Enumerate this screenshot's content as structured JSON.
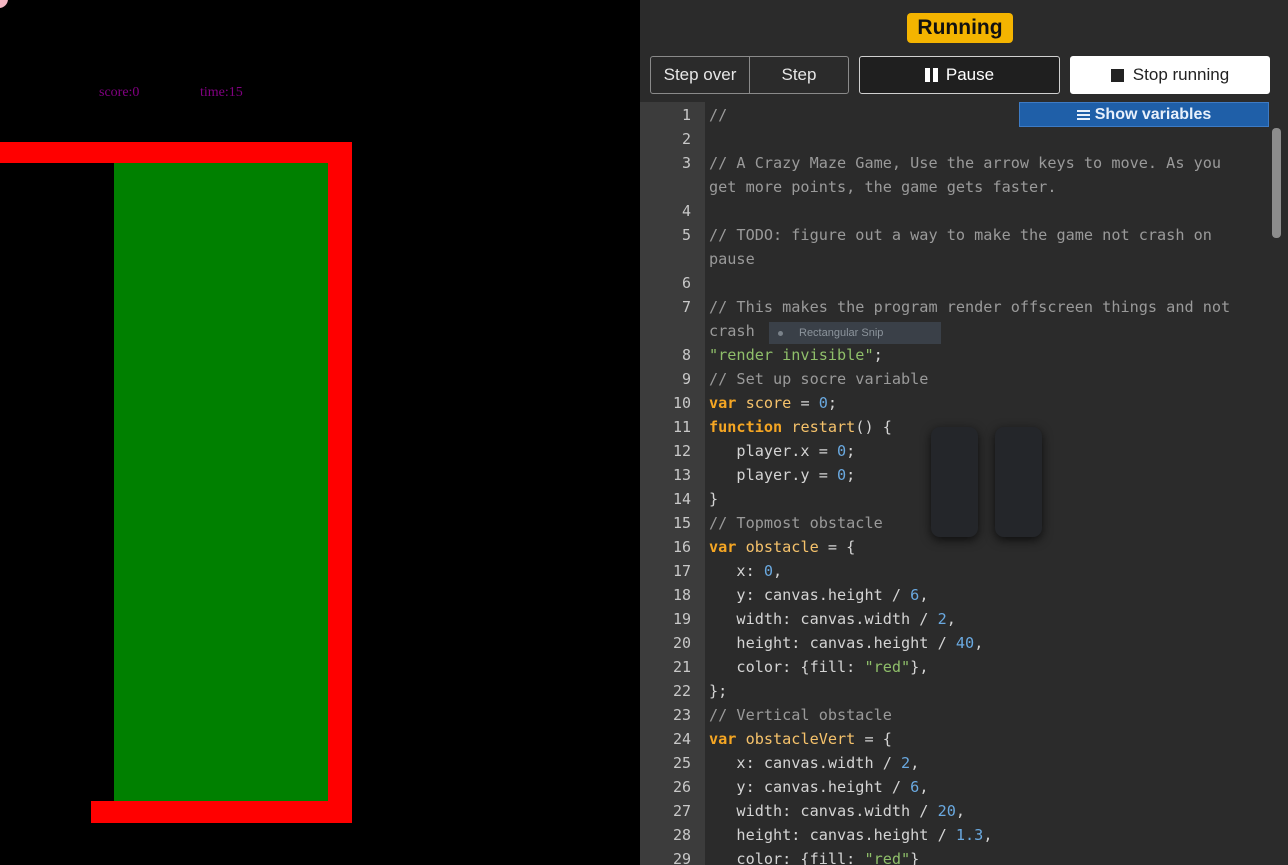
{
  "game": {
    "score_text": "score:0",
    "time_text": "time:15",
    "colors": {
      "background": "#000000",
      "obstacle": "#ff0000",
      "player": "#008000",
      "hud_text": "#800080"
    }
  },
  "toolbar": {
    "status": "Running",
    "step_over_label": "Step over",
    "step_label": "Step",
    "pause_label": "Pause",
    "stop_label": "Stop running",
    "show_variables_label": "Show variables"
  },
  "snip_overlay": {
    "label": "Rectangular Snip"
  },
  "colors": {
    "status_badge": "#f4b400",
    "show_variables": "#1f5fa8",
    "editor_bg": "#2b2b2b",
    "gutter_bg": "#3c3c3c"
  },
  "code": {
    "lines": [
      {
        "n": "1",
        "tokens": [
          [
            "c-com",
            "//"
          ]
        ]
      },
      {
        "n": "2",
        "tokens": []
      },
      {
        "n": "3",
        "tokens": [
          [
            "c-com",
            "// A Crazy Maze Game, Use the arrow keys to move. As you"
          ]
        ],
        "wrap": [
          [
            "c-com",
            "get more points, the game gets faster."
          ]
        ]
      },
      {
        "n": "4",
        "tokens": []
      },
      {
        "n": "5",
        "tokens": [
          [
            "c-com",
            "// TODO: figure out a way to make the game not crash on"
          ]
        ],
        "wrap": [
          [
            "c-com",
            "pause"
          ]
        ]
      },
      {
        "n": "6",
        "tokens": []
      },
      {
        "n": "7",
        "tokens": [
          [
            "c-com",
            "// This makes the program render offscreen things and not"
          ]
        ],
        "wrap": [
          [
            "c-com",
            "crash"
          ]
        ]
      },
      {
        "n": "8",
        "tokens": [
          [
            "c-str",
            "\"render invisible\""
          ],
          [
            "",
            ";"
          ]
        ]
      },
      {
        "n": "9",
        "tokens": [
          [
            "c-com",
            "// Set up socre variable"
          ]
        ]
      },
      {
        "n": "10",
        "tokens": [
          [
            "c-kw",
            "var"
          ],
          [
            "",
            " "
          ],
          [
            "c-fn",
            "score"
          ],
          [
            "",
            " = "
          ],
          [
            "c-num",
            "0"
          ],
          [
            "",
            ";"
          ]
        ]
      },
      {
        "n": "11",
        "tokens": [
          [
            "c-kw",
            "function"
          ],
          [
            "",
            " "
          ],
          [
            "c-fn",
            "restart"
          ],
          [
            "",
            "() {"
          ]
        ]
      },
      {
        "n": "12",
        "tokens": [
          [
            "",
            "   player.x = "
          ],
          [
            "c-num",
            "0"
          ],
          [
            "",
            ";"
          ]
        ]
      },
      {
        "n": "13",
        "tokens": [
          [
            "",
            "   player.y = "
          ],
          [
            "c-num",
            "0"
          ],
          [
            "",
            ";"
          ]
        ]
      },
      {
        "n": "14",
        "tokens": [
          [
            "",
            "}"
          ]
        ]
      },
      {
        "n": "15",
        "tokens": [
          [
            "c-com",
            "// Topmost obstacle"
          ]
        ]
      },
      {
        "n": "16",
        "tokens": [
          [
            "c-kw",
            "var"
          ],
          [
            "",
            " "
          ],
          [
            "c-fn",
            "obstacle"
          ],
          [
            "",
            " = {"
          ]
        ]
      },
      {
        "n": "17",
        "tokens": [
          [
            "",
            "   x: "
          ],
          [
            "c-num",
            "0"
          ],
          [
            "",
            ","
          ]
        ]
      },
      {
        "n": "18",
        "tokens": [
          [
            "",
            "   y: canvas.height / "
          ],
          [
            "c-num",
            "6"
          ],
          [
            "",
            ","
          ]
        ]
      },
      {
        "n": "19",
        "tokens": [
          [
            "",
            "   width: canvas.width / "
          ],
          [
            "c-num",
            "2"
          ],
          [
            "",
            ","
          ]
        ]
      },
      {
        "n": "20",
        "tokens": [
          [
            "",
            "   height: canvas.height / "
          ],
          [
            "c-num",
            "40"
          ],
          [
            "",
            ","
          ]
        ]
      },
      {
        "n": "21",
        "tokens": [
          [
            "",
            "   color: {fill: "
          ],
          [
            "c-str",
            "\"red\""
          ],
          [
            "",
            "},"
          ]
        ]
      },
      {
        "n": "22",
        "tokens": [
          [
            "",
            "};"
          ]
        ]
      },
      {
        "n": "23",
        "tokens": [
          [
            "c-com",
            "// Vertical obstacle"
          ]
        ]
      },
      {
        "n": "24",
        "tokens": [
          [
            "c-kw",
            "var"
          ],
          [
            "",
            " "
          ],
          [
            "c-fn",
            "obstacleVert"
          ],
          [
            "",
            " = {"
          ]
        ]
      },
      {
        "n": "25",
        "tokens": [
          [
            "",
            "   x: canvas.width / "
          ],
          [
            "c-num",
            "2"
          ],
          [
            "",
            ","
          ]
        ]
      },
      {
        "n": "26",
        "tokens": [
          [
            "",
            "   y: canvas.height / "
          ],
          [
            "c-num",
            "6"
          ],
          [
            "",
            ","
          ]
        ]
      },
      {
        "n": "27",
        "tokens": [
          [
            "",
            "   width: canvas.width / "
          ],
          [
            "c-num",
            "20"
          ],
          [
            "",
            ","
          ]
        ]
      },
      {
        "n": "28",
        "tokens": [
          [
            "",
            "   height: canvas.height / "
          ],
          [
            "c-num",
            "1.3"
          ],
          [
            "",
            ","
          ]
        ]
      },
      {
        "n": "29",
        "tokens": [
          [
            "",
            "   color: {fill: "
          ],
          [
            "c-str",
            "\"red\""
          ],
          [
            "",
            "}"
          ]
        ]
      }
    ]
  }
}
